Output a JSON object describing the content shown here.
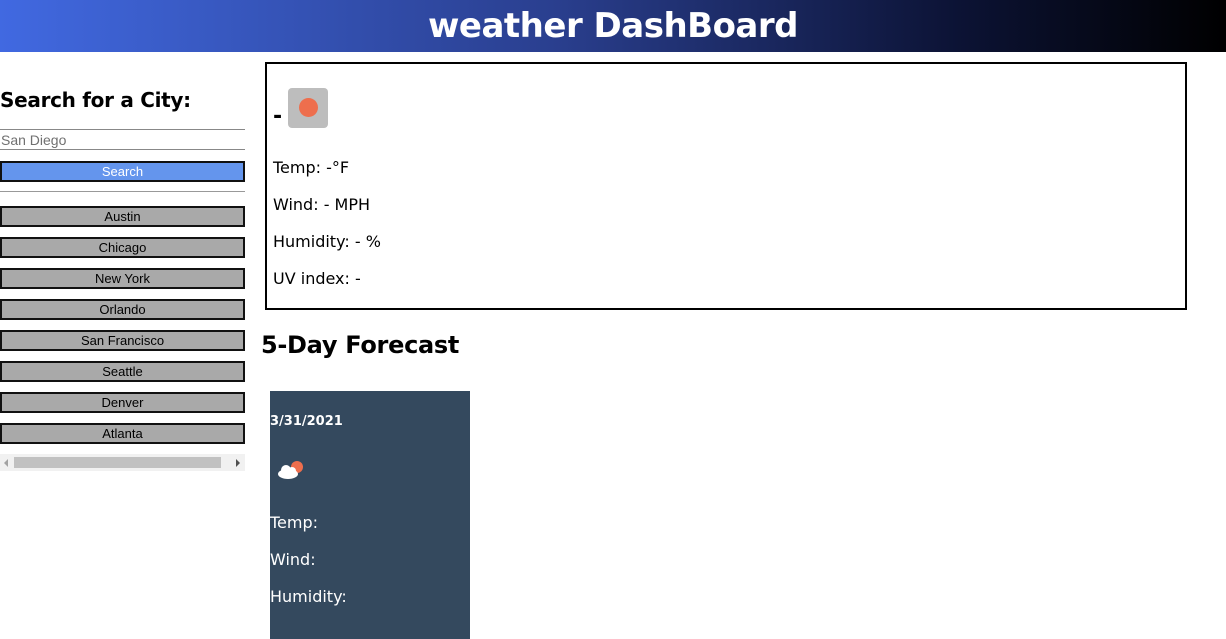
{
  "header": {
    "title": "weather DashBoard"
  },
  "sidebar": {
    "heading": "Search for a City:",
    "search": {
      "value": "",
      "placeholder": "San Diego"
    },
    "search_button": "Search",
    "cities": [
      "Austin",
      "Chicago",
      "New York",
      "Orlando",
      "San Francisco",
      "Seattle",
      "Denver",
      "Atlanta"
    ]
  },
  "current": {
    "city": "-",
    "icon": "sun-icon",
    "temp": "Temp: -°F",
    "wind": "Wind: - MPH",
    "humidity": "Humidity: - %",
    "uv": "UV index:  -"
  },
  "forecast": {
    "title": "5-Day Forecast",
    "days": [
      {
        "date": "3/31/2021",
        "icon": "cloud-sun-icon",
        "temp": "Temp:",
        "wind": "Wind:",
        "humidity": "Humidity:"
      }
    ]
  },
  "colors": {
    "header_start": "#4169e1",
    "header_end": "#000000",
    "search_button": "#6495ed",
    "city_button": "#a9a9a9",
    "forecast_card": "#34495e",
    "sun": "#ee6e4d"
  }
}
